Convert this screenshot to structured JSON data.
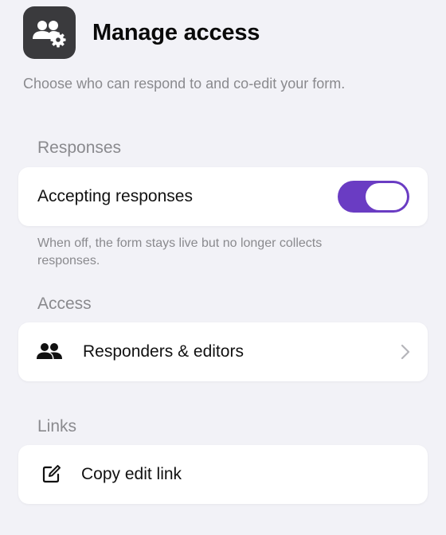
{
  "header": {
    "title": "Manage access",
    "app_icon": "people-settings-icon",
    "subtitle": "Choose who can respond to and co-edit your form."
  },
  "sections": {
    "responses": {
      "label": "Responses",
      "accepting_label": "Accepting responses",
      "toggle_on": true,
      "helper": "When off, the form stays live but no longer collects responses."
    },
    "access": {
      "label": "Access",
      "row_label": "Responders & editors",
      "row_icon": "people-icon",
      "trailing_icon": "chevron-right-icon"
    },
    "links": {
      "label": "Links",
      "row_label": "Copy edit link",
      "row_icon": "edit-icon"
    }
  },
  "colors": {
    "background": "#f2f2f7",
    "toggle_on": "#6a3cc3",
    "app_icon_bg": "#3a3a3d",
    "secondary_text": "#8a8a8e"
  }
}
